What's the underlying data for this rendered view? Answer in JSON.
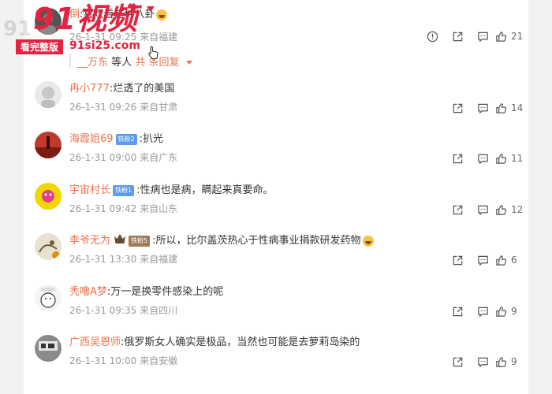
{
  "watermark": {
    "brand": "91视频",
    "ghost": "91",
    "tag": "看完整版",
    "url": "91si25.com"
  },
  "comments": [
    {
      "username": "倒",
      "text": "喜欢看这种八卦",
      "time": "26-1-31 09:25",
      "location": "来自福建",
      "likes": "21",
      "has_report": true,
      "replies": {
        "user": "__万东",
        "text": "等人",
        "more": "共",
        "more2": "条回复"
      },
      "avatar_color": "#555"
    },
    {
      "username": "冉小777",
      "text": "烂透了的美国",
      "time": "26-1-31 09:26",
      "location": "来自甘肃",
      "likes": "14",
      "avatar_color": "#cfcfcf"
    },
    {
      "username": "海霞姐69",
      "badge": "铁粉2",
      "text": "扒光",
      "time": "26-1-31 09:00",
      "location": "来自广东",
      "likes": "11",
      "avatar_color": "#c0392b"
    },
    {
      "username": "宇宙村长",
      "badge": "铁粉1",
      "text": "性病也是病，瞒起来真要命。",
      "time": "26-1-31 09:42",
      "location": "来自山东",
      "likes": "12",
      "avatar_color": "#f1d600"
    },
    {
      "username": "李爷无为",
      "badge": "铁粉5",
      "text": "所以，比尔盖茨热心于性病事业捐款研发药物",
      "time": "26-1-31 13:30",
      "location": "来自福建",
      "likes": "6",
      "avatar_color": "#d9cfb8"
    },
    {
      "username": "秃噜A梦",
      "text": "万一是换零件感染上的呢",
      "time": "26-1-31 09:35",
      "location": "来自四川",
      "likes": "9",
      "avatar_color": "#f4f4f4"
    },
    {
      "username": "广西吴恩师",
      "text": "俄罗斯女人确实是极品，当然也可能是去萝莉岛染的",
      "time": "26-1-31 10:00",
      "location": "来自安徽",
      "likes": "9",
      "avatar_color": "#777"
    }
  ],
  "icons": {
    "report": "report-icon",
    "share": "share-icon",
    "comment": "comment-icon",
    "like": "thumbs-up-icon",
    "crown": "crown-icon",
    "emoji": "grin-emoji-icon",
    "cursor": "hand-cursor-icon"
  },
  "colors": {
    "username": "#eb7350",
    "meta": "#999999",
    "badge": "#5d9cec",
    "watermark": "#e3233f"
  }
}
